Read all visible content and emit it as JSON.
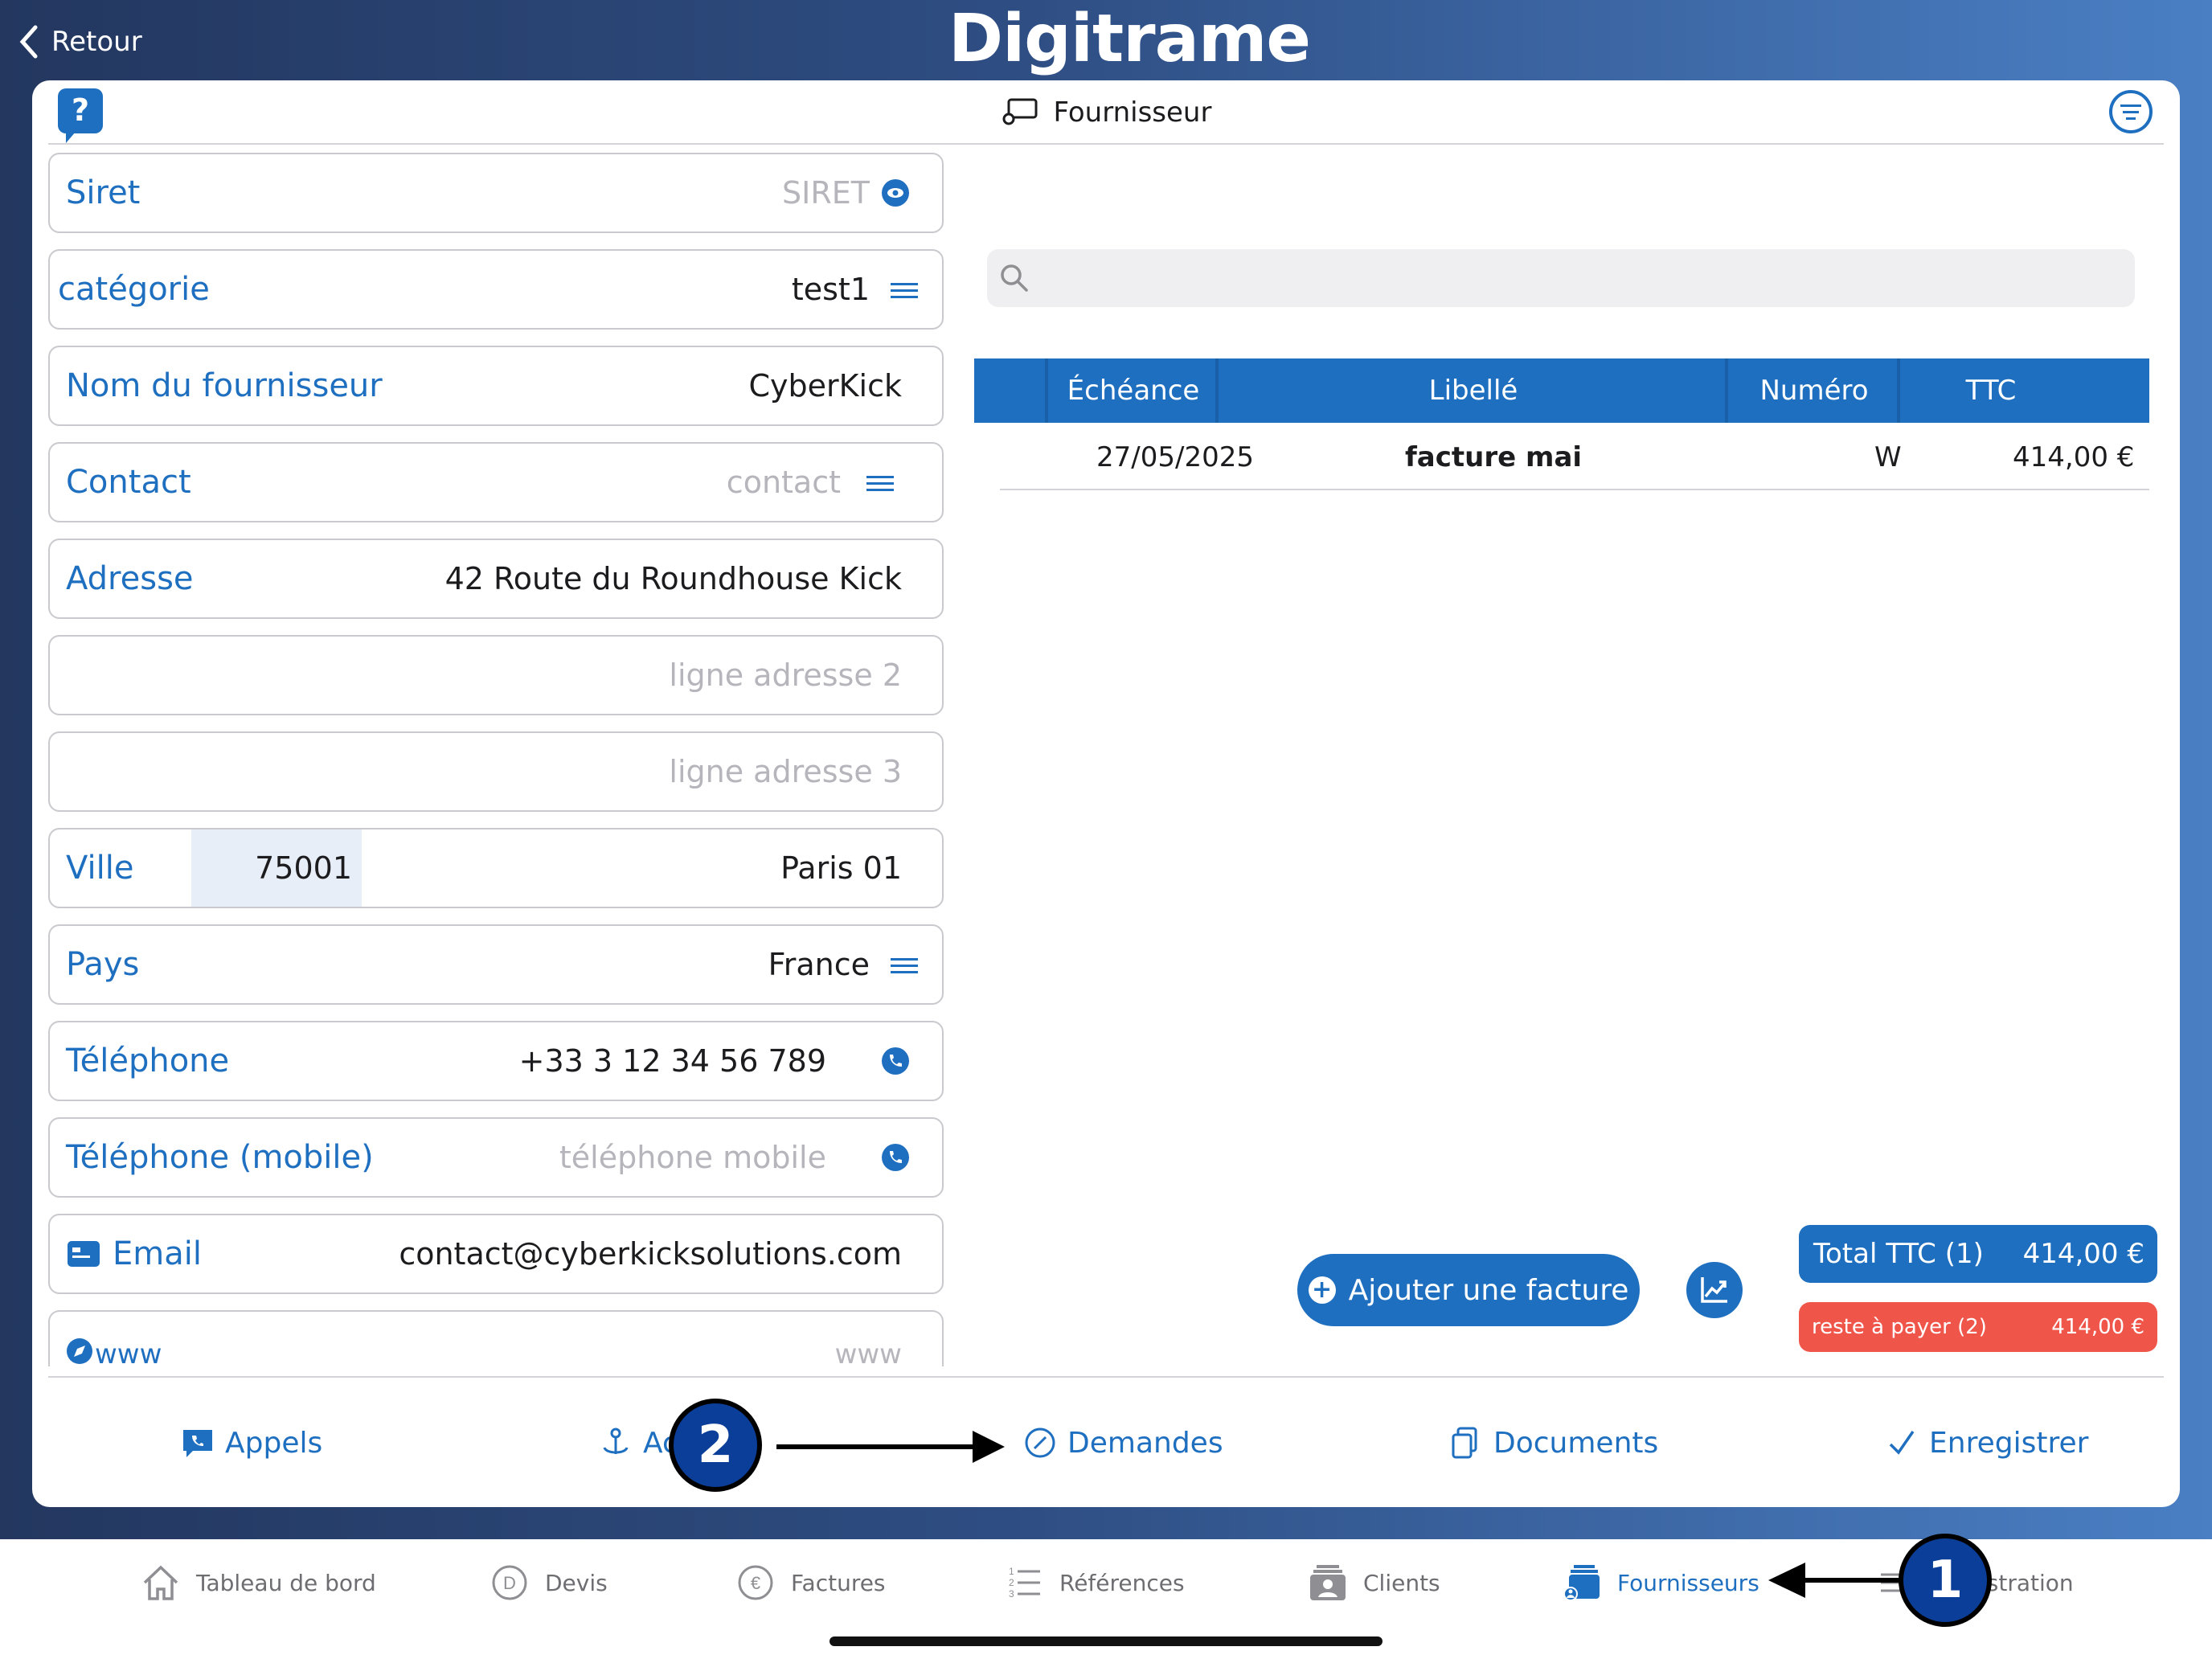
{
  "header": {
    "back_label": "Retour",
    "logo_text": "Digitrame"
  },
  "card": {
    "title": "Fournisseur"
  },
  "form": {
    "siret": {
      "label": "Siret",
      "placeholder": "SIRET"
    },
    "categorie": {
      "label": "catégorie",
      "value": "test1"
    },
    "nom": {
      "label": "Nom du fournisseur",
      "value": "CyberKick"
    },
    "contact": {
      "label": "Contact",
      "placeholder": "contact"
    },
    "adresse": {
      "label": "Adresse",
      "value": "42 Route du Roundhouse Kick"
    },
    "adresse2": {
      "placeholder": "ligne adresse 2"
    },
    "adresse3": {
      "placeholder": "ligne adresse 3"
    },
    "ville": {
      "label": "Ville",
      "zip": "75001",
      "city": "Paris 01"
    },
    "pays": {
      "label": "Pays",
      "value": "France"
    },
    "telephone": {
      "label": "Téléphone",
      "value": "+33 3 12 34 56 789"
    },
    "mobile": {
      "label": "Téléphone (mobile)",
      "placeholder": "téléphone mobile"
    },
    "email": {
      "label": "Email",
      "value": "contact@cyberkicksolutions.com"
    },
    "www": {
      "label": "www",
      "placeholder": "www"
    }
  },
  "table": {
    "headers": [
      "Échéance",
      "Libellé",
      "Numéro",
      "TTC"
    ],
    "rows": [
      {
        "echeance": "27/05/2025",
        "libelle": "facture mai",
        "numero": "W",
        "ttc": "414,00 €"
      }
    ]
  },
  "buttons": {
    "add_invoice": "Ajouter une facture"
  },
  "totals": {
    "total_label": "Total TTC   (1)",
    "total_value": "414,00 €",
    "reste_label": "reste à payer  (2)",
    "reste_value": "414,00 €"
  },
  "actions": {
    "appels": "Appels",
    "ac": "Ac",
    "demandes": "Demandes",
    "documents": "Documents",
    "enregistrer": "Enregistrer"
  },
  "tabs": {
    "tableau": "Tableau de bord",
    "devis": "Devis",
    "factures": "Factures",
    "references": "Références",
    "clients": "Clients",
    "fournisseurs": "Fournisseurs",
    "administration": "istration"
  },
  "annotations": {
    "one": "1",
    "two": "2"
  },
  "colors": {
    "accent": "#1f6fc0",
    "alert": "#f0554a",
    "annotation": "#0b3e99"
  }
}
